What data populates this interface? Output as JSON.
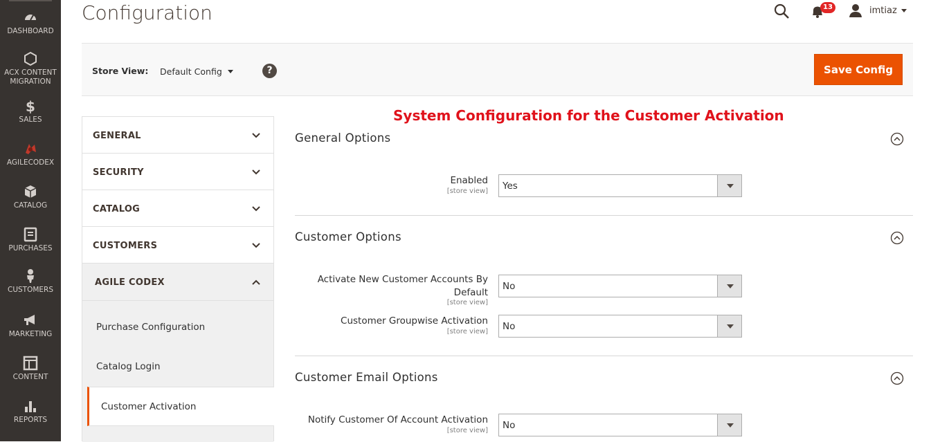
{
  "nav": {
    "items": [
      {
        "label": "DASHBOARD",
        "icon": "speedometer-icon"
      },
      {
        "label": "ACX CONTENT MIGRATION",
        "icon": "hexagon-icon"
      },
      {
        "label": "SALES",
        "icon": "dollar-icon"
      },
      {
        "label": "AGILECODEX",
        "icon": "agilecodex-logo-icon"
      },
      {
        "label": "CATALOG",
        "icon": "box-icon"
      },
      {
        "label": "PURCHASES",
        "icon": "document-icon"
      },
      {
        "label": "CUSTOMERS",
        "icon": "person-icon"
      },
      {
        "label": "MARKETING",
        "icon": "megaphone-icon"
      },
      {
        "label": "CONTENT",
        "icon": "layout-icon"
      },
      {
        "label": "REPORTS",
        "icon": "bar-chart-icon"
      }
    ]
  },
  "header": {
    "title": "Configuration",
    "notification_count": "13",
    "user_name": "imtiaz"
  },
  "store_bar": {
    "label": "Store View:",
    "value": "Default Config",
    "help": "?",
    "save_label": "Save Config"
  },
  "tabs": {
    "items": [
      {
        "label": "GENERAL",
        "state": "collapsed"
      },
      {
        "label": "SECURITY",
        "state": "collapsed"
      },
      {
        "label": "CATALOG",
        "state": "collapsed"
      },
      {
        "label": "CUSTOMERS",
        "state": "collapsed"
      },
      {
        "label": "AGILE CODEX",
        "state": "expanded"
      }
    ],
    "sub_items": [
      {
        "label": "Purchase Configuration"
      },
      {
        "label": "Catalog Login"
      },
      {
        "label": "Customer Activation",
        "active": true
      }
    ]
  },
  "annotation": "System Configuration for the Customer Activation",
  "sections": {
    "general": {
      "title": "General Options",
      "fields": {
        "enabled": {
          "label": "Enabled",
          "scope": "[store view]",
          "value": "Yes"
        }
      }
    },
    "customer": {
      "title": "Customer Options",
      "fields": {
        "activate_default": {
          "label_line1": "Activate New Customer Accounts By",
          "label_line2": "Default",
          "scope": "[store view]",
          "value": "No"
        },
        "groupwise": {
          "label": "Customer Groupwise Activation",
          "scope": "[store view]",
          "value": "No"
        }
      }
    },
    "email": {
      "title": "Customer Email Options",
      "fields": {
        "notify": {
          "label": "Notify Customer Of Account Activation",
          "scope": "[store view]",
          "value": "No"
        }
      }
    }
  },
  "colors": {
    "accent": "#eb5202",
    "nav_bg": "#373330",
    "annotation": "#e0121b",
    "badge": "#e22626"
  }
}
